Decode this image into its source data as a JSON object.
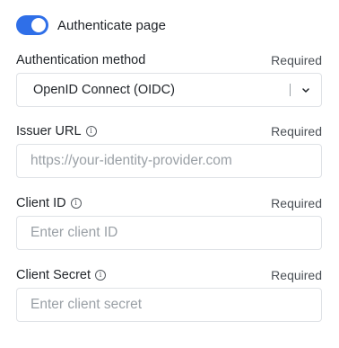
{
  "toggle": {
    "label": "Authenticate page",
    "on": true
  },
  "auth_method": {
    "label": "Authentication method",
    "required": "Required",
    "selected": "OpenID Connect (OIDC)"
  },
  "issuer_url": {
    "label": "Issuer URL",
    "required": "Required",
    "placeholder": "https://your-identity-provider.com",
    "value": ""
  },
  "client_id": {
    "label": "Client ID",
    "required": "Required",
    "placeholder": "Enter client ID",
    "value": ""
  },
  "client_secret": {
    "label": "Client Secret",
    "required": "Required",
    "placeholder": "Enter client secret",
    "value": ""
  },
  "icons": {
    "info": "info-icon",
    "chevron": "chevron-down-icon"
  },
  "colors": {
    "accent": "#2f6fe8",
    "border": "#dfe2e6",
    "placeholder": "#9aa0a6"
  }
}
